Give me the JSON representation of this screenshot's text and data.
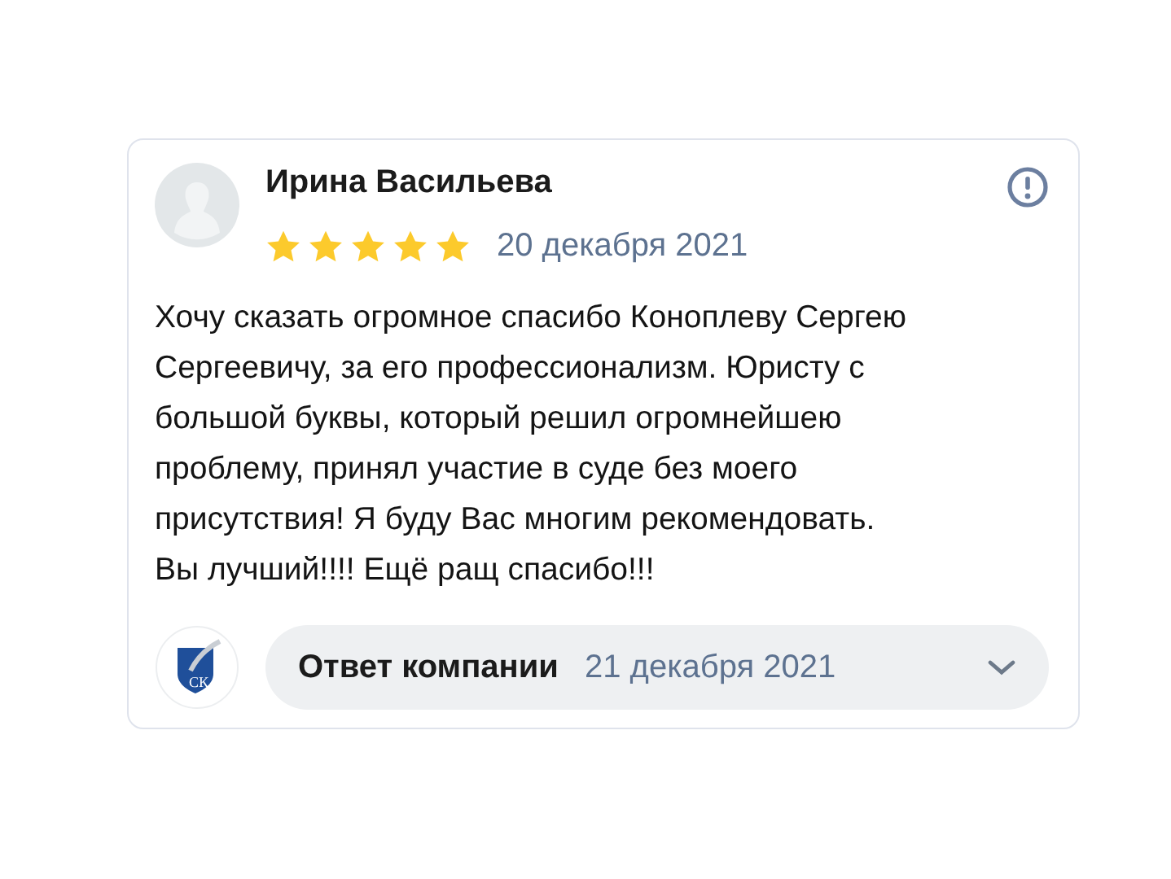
{
  "review": {
    "author": "Ирина Васильева",
    "stars": 5,
    "date": "20 декабря 2021",
    "text_lines": [
      "Хочу сказать огромное спасибо Коноплеву Сергею",
      "Сергеевичу, за его профессионализм. Юристу с",
      "большой буквы, который решил огромнейшею",
      "проблему, принял участие в суде без моего",
      "присутствия! Я буду Вас многим рекомендовать.",
      "Вы лучший!!!! Ещё ращ спасибо!!!"
    ]
  },
  "reply": {
    "logo_text": "СК",
    "label": "Ответ компании",
    "date": "21 декабря 2021",
    "expanded": false
  }
}
